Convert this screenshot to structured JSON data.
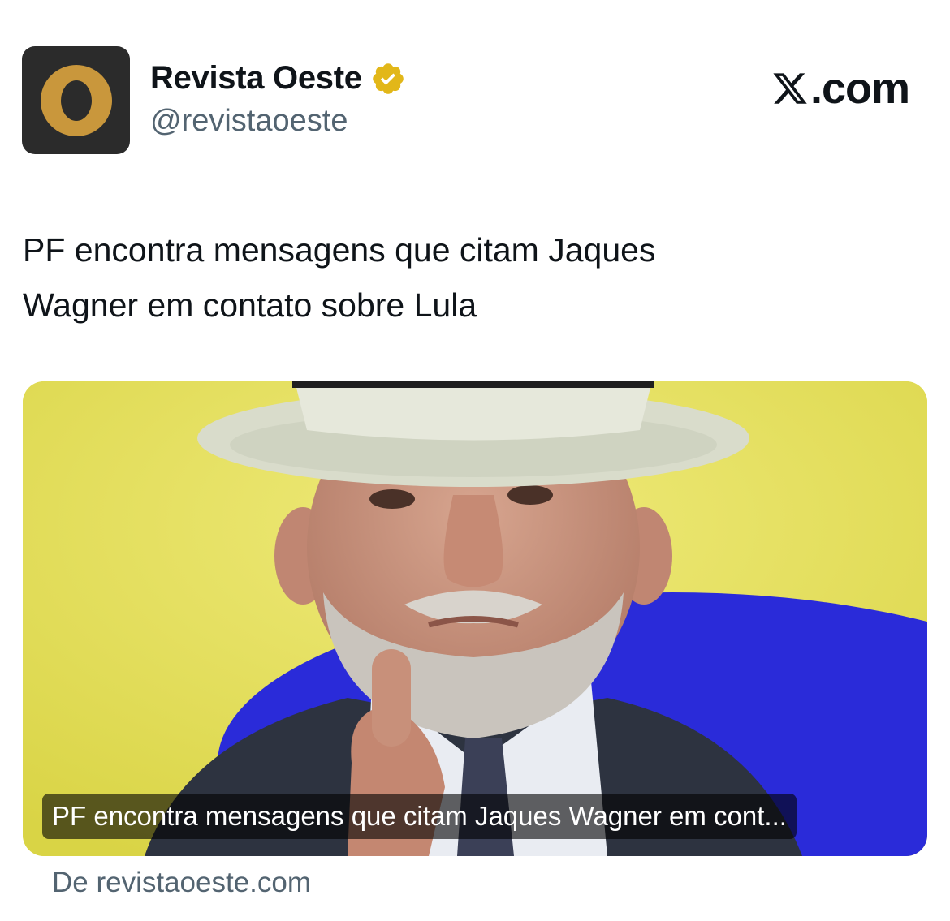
{
  "account": {
    "display_name": "Revista Oeste",
    "handle": "@revistaoeste",
    "avatar_icon": "revista-oeste-logo",
    "verified_icon": "verified-badge-gold",
    "verified_color": "#e2b719"
  },
  "brand": {
    "site": ".com",
    "logo_icon": "x-logo"
  },
  "tweet": {
    "text": "PF encontra mensagens que citam Jaques\nWagner em contato sobre Lula"
  },
  "card": {
    "image_icon": "man-in-white-hat-pointing-photo",
    "caption": "PF encontra mensagens que citam Jaques Wagner em cont...",
    "source": "De revistaoeste.com"
  },
  "colors": {
    "text_primary": "#0f1419",
    "text_secondary": "#536471",
    "avatar_bg": "#2b2b2b",
    "avatar_gold": "#c9973c",
    "photo_yellow": "#e6e25a",
    "photo_blue": "#2a2bd9"
  }
}
